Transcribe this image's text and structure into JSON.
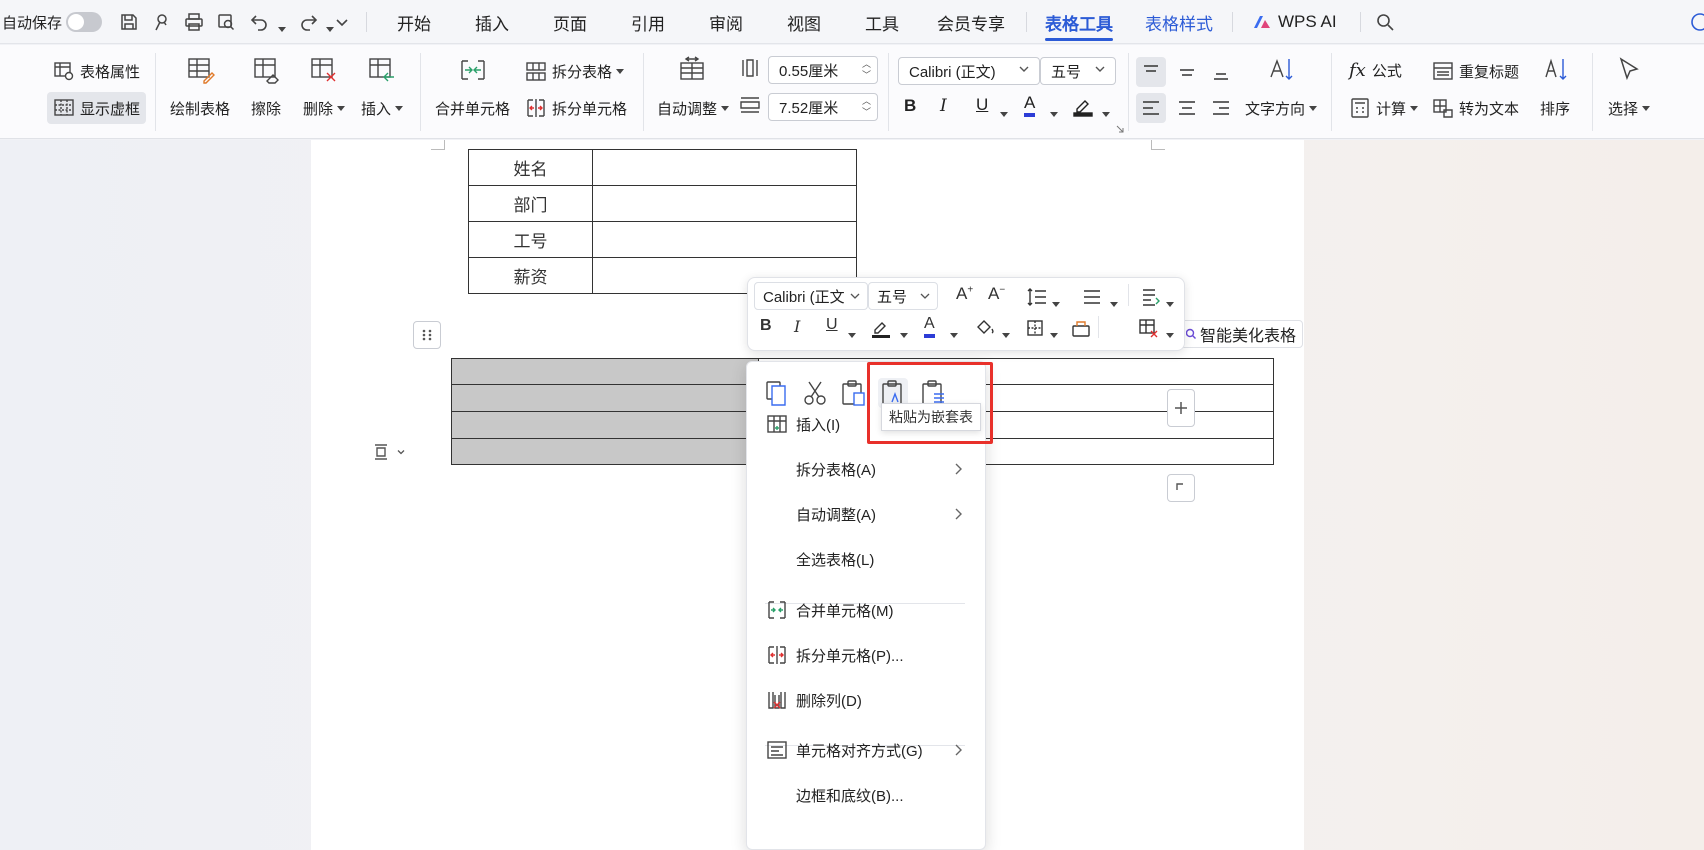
{
  "titlebar": {
    "autosave_label": "自动保存",
    "tabs": [
      "开始",
      "插入",
      "页面",
      "引用",
      "审阅",
      "视图",
      "工具",
      "会员专享",
      "表格工具",
      "表格样式"
    ],
    "wps_ai_label": "WPS AI",
    "active_tab": "表格工具",
    "accent_color": "#2c5bd6"
  },
  "ribbon": {
    "table_properties": "表格属性",
    "show_gridlines": "显示虚框",
    "draw_table": "绘制表格",
    "erase": "擦除",
    "delete": "删除",
    "insert": "插入",
    "merge_cells": "合并单元格",
    "split_table": "拆分表格",
    "split_cells": "拆分单元格",
    "auto_fit": "自动调整",
    "row_height": "0.55厘米",
    "col_width": "7.52厘米",
    "font_name": "Calibri (正文)",
    "font_size": "五号",
    "text_direction": "文字方向",
    "formula": "公式",
    "repeat_header": "重复标题",
    "calculate": "计算",
    "convert_to_text": "转为文本",
    "sort": "排序",
    "select": "选择"
  },
  "document": {
    "table1_rows": [
      "姓名",
      "部门",
      "工号",
      "薪资"
    ],
    "beautify_table": "智能美化表格"
  },
  "floatbar": {
    "font_name": "Calibri (正文",
    "font_size": "五号"
  },
  "context_menu": {
    "tooltip": "粘贴为嵌套表",
    "items": [
      {
        "label": "插入(I)",
        "submenu": true
      },
      {
        "label": "拆分表格(A)",
        "submenu": true
      },
      {
        "label": "自动调整(A)",
        "submenu": true
      },
      {
        "label": "全选表格(L)",
        "submenu": false
      },
      {
        "label": "合并单元格(M)",
        "submenu": false
      },
      {
        "label": "拆分单元格(P)...",
        "submenu": false
      },
      {
        "label": "删除列(D)",
        "submenu": false
      },
      {
        "label": "单元格对齐方式(G)",
        "submenu": true
      },
      {
        "label": "边框和底纹(B)...",
        "submenu": false
      }
    ]
  }
}
